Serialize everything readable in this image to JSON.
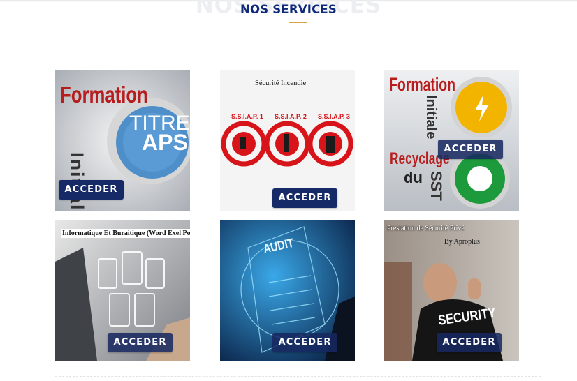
{
  "section": {
    "ghost_title": "NOS SERVICES",
    "title": "NOS SERVICES"
  },
  "colors": {
    "title": "#0e2a78",
    "underline": "#d9a441",
    "button": "#152a66"
  },
  "cards": [
    {
      "image_text": {
        "title": "Formation",
        "word": "Initiale",
        "badge": "TITRE",
        "badge_big": "APS"
      },
      "button": "ACCEDER"
    },
    {
      "image_text": {
        "caption": "Sécurité Incendie",
        "labels": [
          "S.S.I.A.P. 1",
          "S.S.I.A.P. 2",
          "S.S.I.A.P. 3"
        ]
      },
      "button": "ACCEDER"
    },
    {
      "image_text": {
        "title": "Formation",
        "word": "Initiale",
        "recycle": "Recyclage",
        "du": "du",
        "sst": "SST"
      },
      "button": "ACCEDER"
    },
    {
      "image_text": {
        "caption": "Informatique Et Buraitique (Word Exel Power Point)"
      },
      "button": "ACCEDER"
    },
    {
      "image_text": {
        "audit": "AUDIT"
      },
      "button": "ACCEDER"
    },
    {
      "image_text": {
        "caption": "Prestation de Sécurité Privé",
        "by": "By Aproplus",
        "security": "SECURITY"
      },
      "button": "ACCEDER"
    }
  ]
}
